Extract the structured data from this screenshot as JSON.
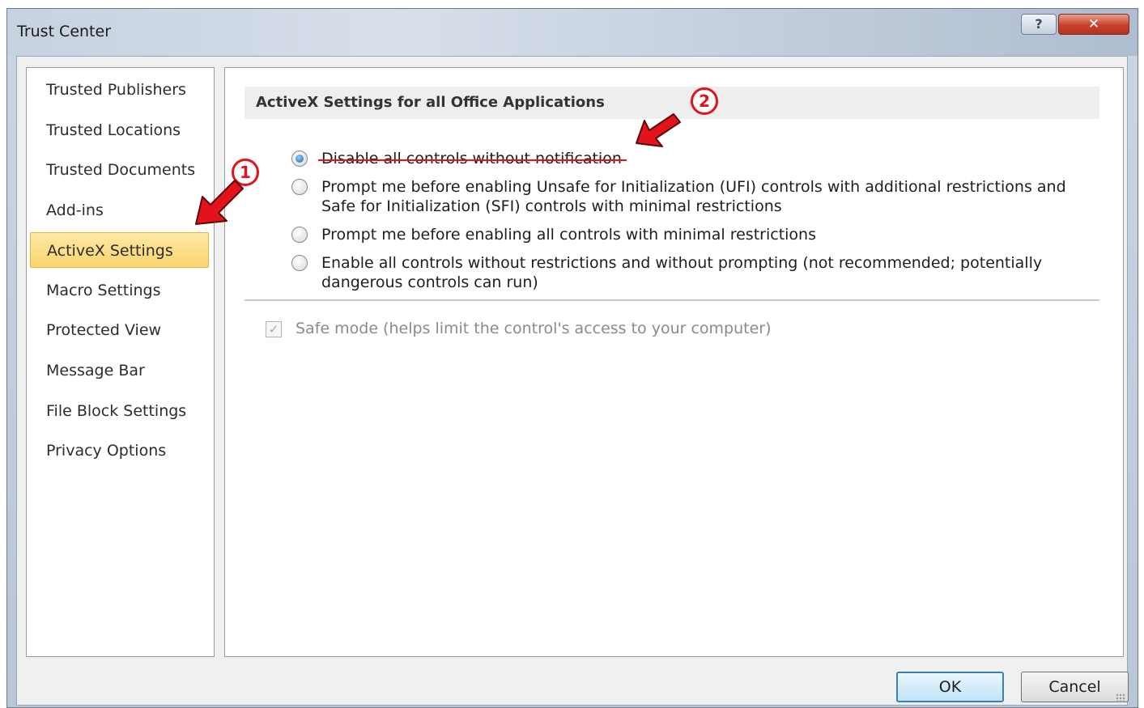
{
  "window": {
    "title": "Trust Center",
    "help_glyph": "?",
    "close_glyph": "✕"
  },
  "sidebar": {
    "items": [
      {
        "label": "Trusted Publishers"
      },
      {
        "label": "Trusted Locations"
      },
      {
        "label": "Trusted Documents"
      },
      {
        "label": "Add-ins"
      },
      {
        "label": "ActiveX Settings",
        "selected": true
      },
      {
        "label": "Macro Settings"
      },
      {
        "label": "Protected View"
      },
      {
        "label": "Message Bar"
      },
      {
        "label": "File Block Settings"
      },
      {
        "label": "Privacy Options"
      }
    ]
  },
  "main": {
    "section_title": "ActiveX Settings for all Office Applications",
    "options": [
      {
        "line1": "Disable all controls without notification",
        "line2": "",
        "checked": true
      },
      {
        "line1": "Prompt me before enabling Unsafe for Initialization (UFI) controls with additional restrictions and",
        "line2": "Safe for Initialization (SFI) controls with minimal restrictions",
        "checked": false
      },
      {
        "line1": "Prompt me before enabling all controls with minimal restrictions",
        "line2": "",
        "checked": false
      },
      {
        "line1": "Enable all controls without restrictions and without prompting (not recommended; potentially",
        "line2": "dangerous controls can run)",
        "checked": false
      }
    ],
    "safe_mode": {
      "label": "Safe mode (helps limit the control's access to your computer)",
      "checked": true,
      "enabled": false
    }
  },
  "footer": {
    "ok_label": "OK",
    "cancel_label": "Cancel"
  },
  "annotations": {
    "badge1": "1",
    "badge2": "2",
    "color": "#e3121b"
  },
  "icons": [
    "help-icon",
    "close-icon",
    "radio-icon",
    "checkbox-icon",
    "arrow-icon",
    "resize-grip-icon"
  ]
}
